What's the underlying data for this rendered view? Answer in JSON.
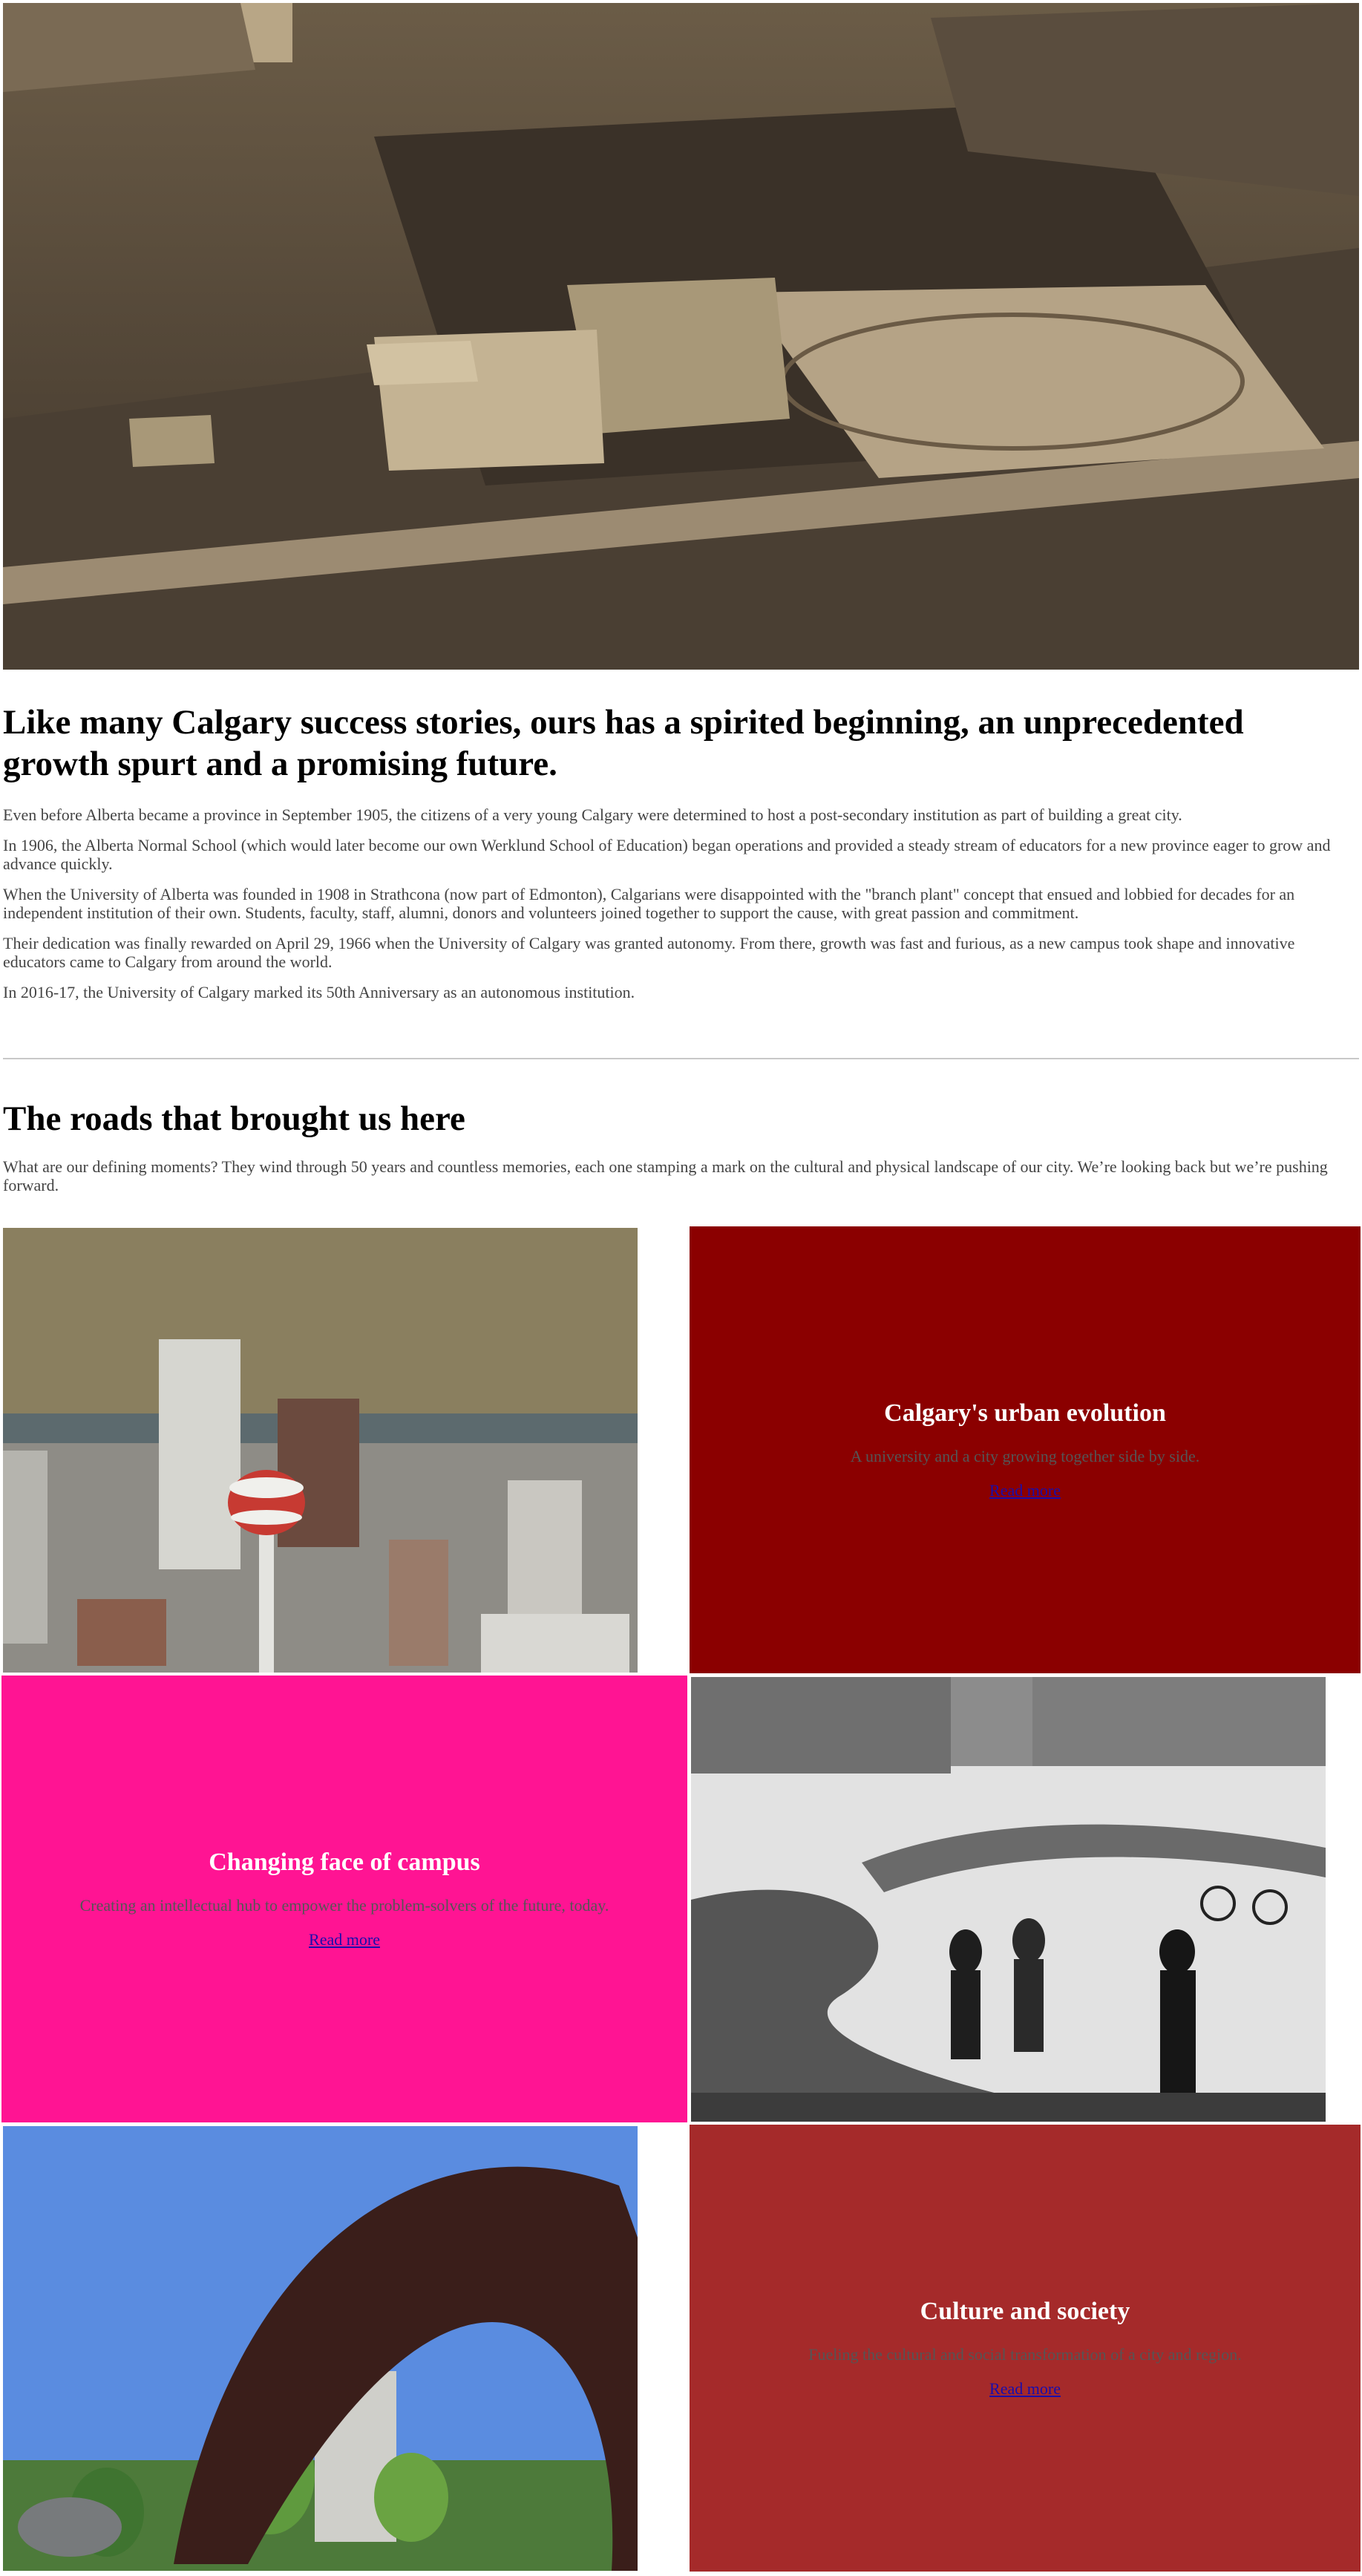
{
  "hero": {
    "image": "aerial-campus-photo-sepia"
  },
  "intro": {
    "heading": "Like many Calgary success stories, ours has a spirited beginning, an unprecedented growth spurt and a promising future.",
    "paragraphs": [
      "Even before Alberta became a province in September 1905, the citizens of a very young Calgary were determined to host a post-secondary institution as part of building a great city.",
      "In 1906, the Alberta Normal School (which would later become our own Werklund School of Education) began operations and provided a steady stream of educators for a new province eager to grow and advance quickly.",
      "When the University of Alberta was founded in 1908 in Strathcona (now part of Edmonton), Calgarians were disappointed with the \"branch plant\" concept that ensued and lobbied for decades for an independent institution of their own. Students, faculty, staff, alumni, donors and volunteers joined together to support the cause, with great passion and commitment.",
      "Their dedication was finally rewarded on April 29, 1966 when the University of Calgary was granted autonomy. From there, growth was fast and furious, as a new campus took shape and innovative educators came to Calgary from around the world.",
      "In 2016-17, the University of Calgary marked its 50th Anniversary as an autonomous institution."
    ]
  },
  "roads": {
    "heading": "The roads that brought us here",
    "intro": "What are our defining moments? They wind through 50 years and countless memories, each one stamping a mark on the cultural and physical landscape of our city. We’re looking back but we’re pushing forward."
  },
  "cards": [
    {
      "title": "Calgary's urban evolution",
      "description": "A university and a city growing together side by side.",
      "link": "Read more",
      "color": "#8b0000",
      "image": "calgary-tower-aerial-photo"
    },
    {
      "title": "Changing face of campus",
      "description": "Creating an intellectual hub to empower the problem-solvers of the future, today.",
      "link": "Read more",
      "color": "#ff1493",
      "image": "winter-campus-photo-bw"
    },
    {
      "title": "Culture and society",
      "description": "Fueling the cultural and social transformation of a city and region.",
      "link": "Read more",
      "color": "#a52a2a",
      "image": "arch-sculpture-photo"
    }
  ]
}
